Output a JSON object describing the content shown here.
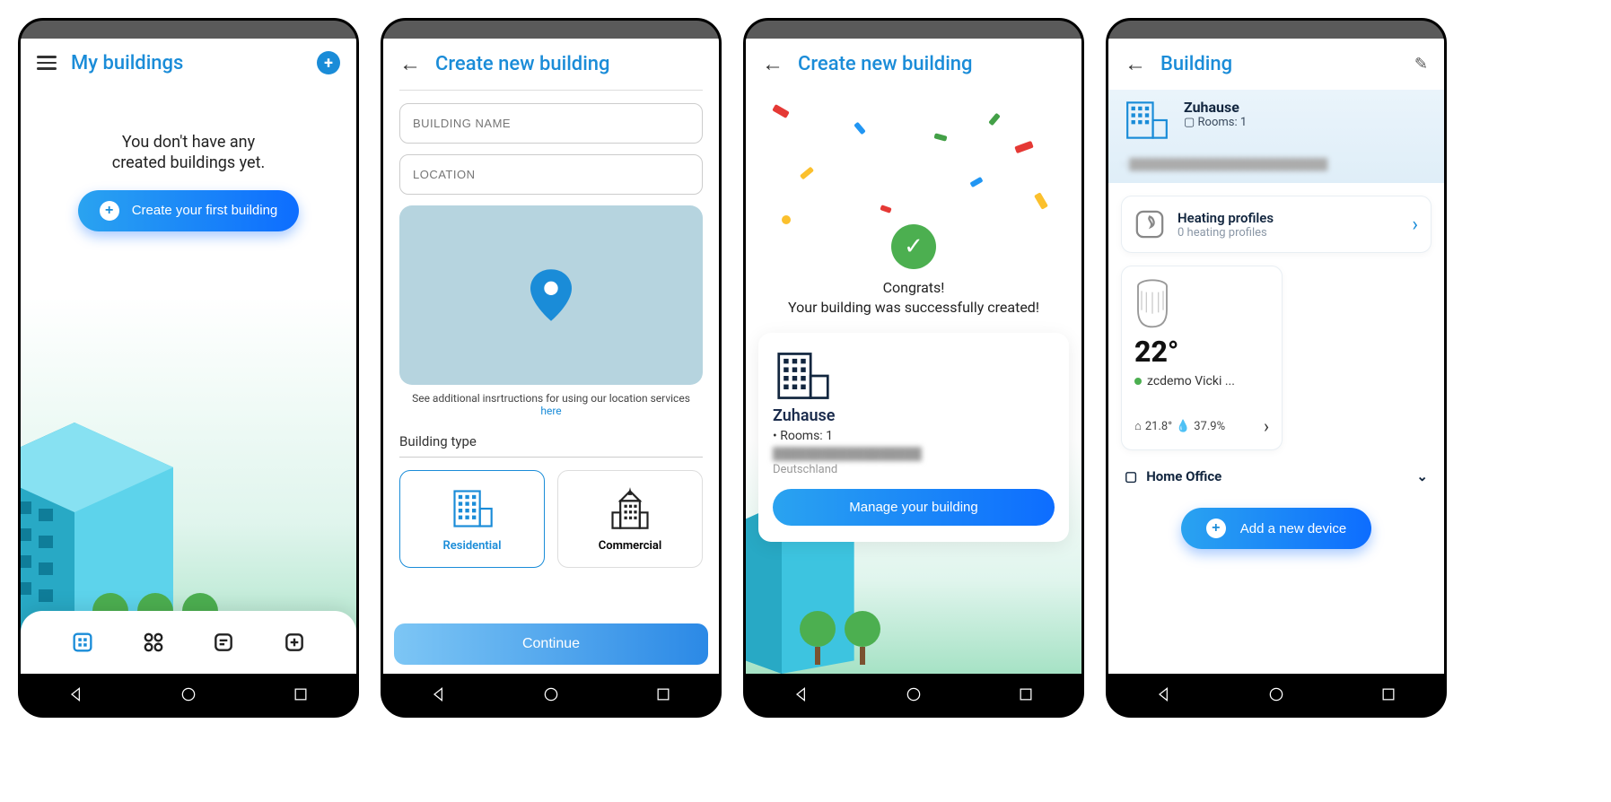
{
  "screen1": {
    "title": "My buildings",
    "empty_line1": "You don't have any",
    "empty_line2": "created buildings yet.",
    "create_btn": "Create your first building"
  },
  "screen2": {
    "title": "Create new building",
    "name_placeholder": "BUILDING NAME",
    "location_placeholder": "LOCATION",
    "hint": "See additional insrtructions for using our location services",
    "hint_link": "here",
    "type_label": "Building type",
    "type_residential": "Residential",
    "type_commercial": "Commercial",
    "continue": "Continue"
  },
  "screen3": {
    "title": "Create new building",
    "congrats_title": "Congrats!",
    "congrats_sub": "Your building was successfully created!",
    "building_name": "Zuhause",
    "rooms_label": "Rooms: 1",
    "addr_redacted": "██████████████████",
    "country": "Deutschland",
    "manage_btn": "Manage your building"
  },
  "screen4": {
    "title": "Building",
    "building_name": "Zuhause",
    "rooms_label": "Rooms: 1",
    "addr_redacted": "██████████████████████████",
    "hp_title": "Heating profiles",
    "hp_sub": "0 heating profiles",
    "temp": "22°",
    "device_name": "zcdemo Vicki ...",
    "stat_temp": "21.8°",
    "stat_hum": "37.9%",
    "room_name": "Home Office",
    "add_device": "Add a new device"
  }
}
